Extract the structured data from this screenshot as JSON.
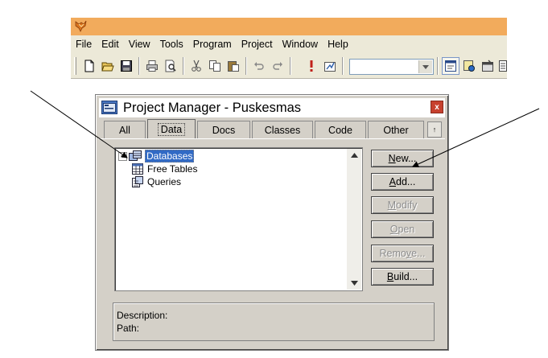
{
  "menu": [
    "File",
    "Edit",
    "View",
    "Tools",
    "Program",
    "Project",
    "Window",
    "Help"
  ],
  "toolbar": {
    "icons": [
      "new-file-icon",
      "open-folder-icon",
      "save-icon",
      "print-icon",
      "print-preview-icon",
      "cut-icon",
      "copy-icon",
      "paste-icon",
      "undo-icon",
      "redo-icon",
      "run-icon",
      "modify-form-icon"
    ],
    "combo_value": "",
    "right_icons": [
      "command-window-icon",
      "data-session-icon",
      "form-designer-icon"
    ]
  },
  "dialog": {
    "title": "Project Manager - Puskesmas",
    "close_glyph": "x",
    "tabs": [
      "All",
      "Data",
      "Docs",
      "Classes",
      "Code",
      "Other"
    ],
    "active_tab": "Data",
    "tab_scroll_glyph": "↑",
    "tree": [
      {
        "label": "Databases",
        "expander": "+",
        "selected": true
      },
      {
        "label": "Free Tables"
      },
      {
        "label": "Queries"
      }
    ],
    "buttons": {
      "new": {
        "pre": "",
        "u": "N",
        "post": "ew..."
      },
      "add": {
        "pre": "",
        "u": "A",
        "post": "dd..."
      },
      "modify": {
        "pre": "",
        "u": "M",
        "post": "odify"
      },
      "open": {
        "pre": "",
        "u": "O",
        "post": "pen"
      },
      "remove": {
        "pre": "Remo",
        "u": "v",
        "post": "e..."
      },
      "build": {
        "pre": "",
        "u": "B",
        "post": "uild..."
      }
    },
    "description_label": "Description:",
    "path_label": "Path:"
  },
  "colors": {
    "app_titlebar": "#f2ab5c",
    "selection": "#316ac5",
    "close_button": "#c7412e",
    "dialog_face": "#d4d0c8"
  }
}
